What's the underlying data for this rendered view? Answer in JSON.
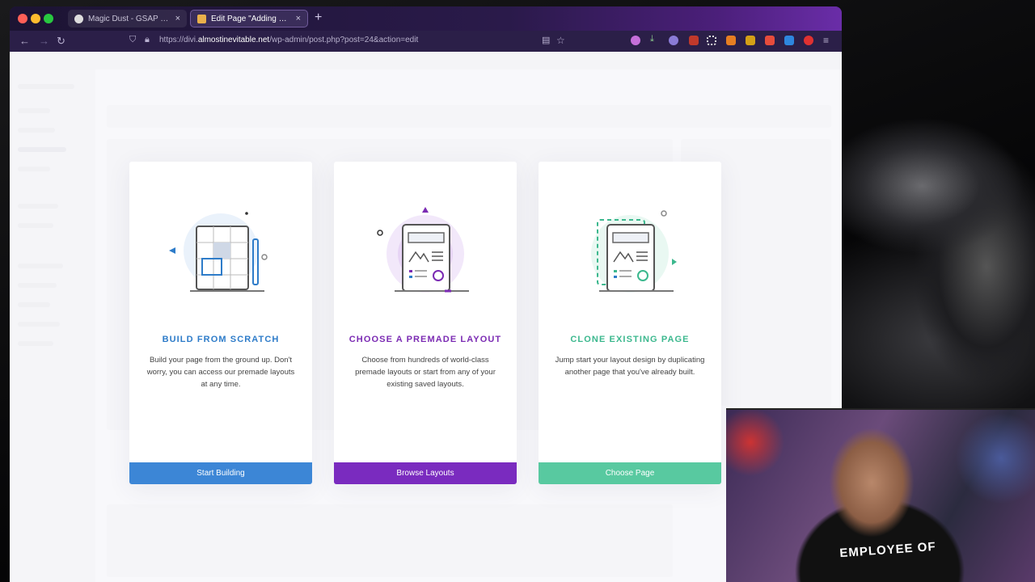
{
  "browser": {
    "tabs": [
      {
        "label": "Magic Dust - GSAP Canvas Pa",
        "active": false
      },
      {
        "label": "Edit Page \"Adding Codepen\" ‹ A",
        "active": true
      }
    ],
    "new_tab": "+",
    "close_glyph": "×",
    "url_prefix": "https://divi.",
    "url_domain": "almostinevitable.net",
    "url_path": "/wp-admin/post.php?post=24&action=edit",
    "accent": "#6a2da8"
  },
  "cards": [
    {
      "title": "BUILD FROM SCRATCH",
      "description": "Build your page from the ground up. Don't worry, you can access our premade layouts at any time.",
      "button": "Start Building",
      "color": "#3c86d6"
    },
    {
      "title": "CHOOSE A PREMADE LAYOUT",
      "description": "Choose from hundreds of world-class premade layouts or start from any of your existing saved layouts.",
      "button": "Browse Layouts",
      "color": "#7a2bbf"
    },
    {
      "title": "CLONE EXISTING PAGE",
      "description": "Jump start your layout design by duplicating another page that you've already built.",
      "button": "Choose Page",
      "color": "#58c9a0"
    }
  ],
  "webcam": {
    "shirt_text": "EMPLOYEE OF"
  }
}
